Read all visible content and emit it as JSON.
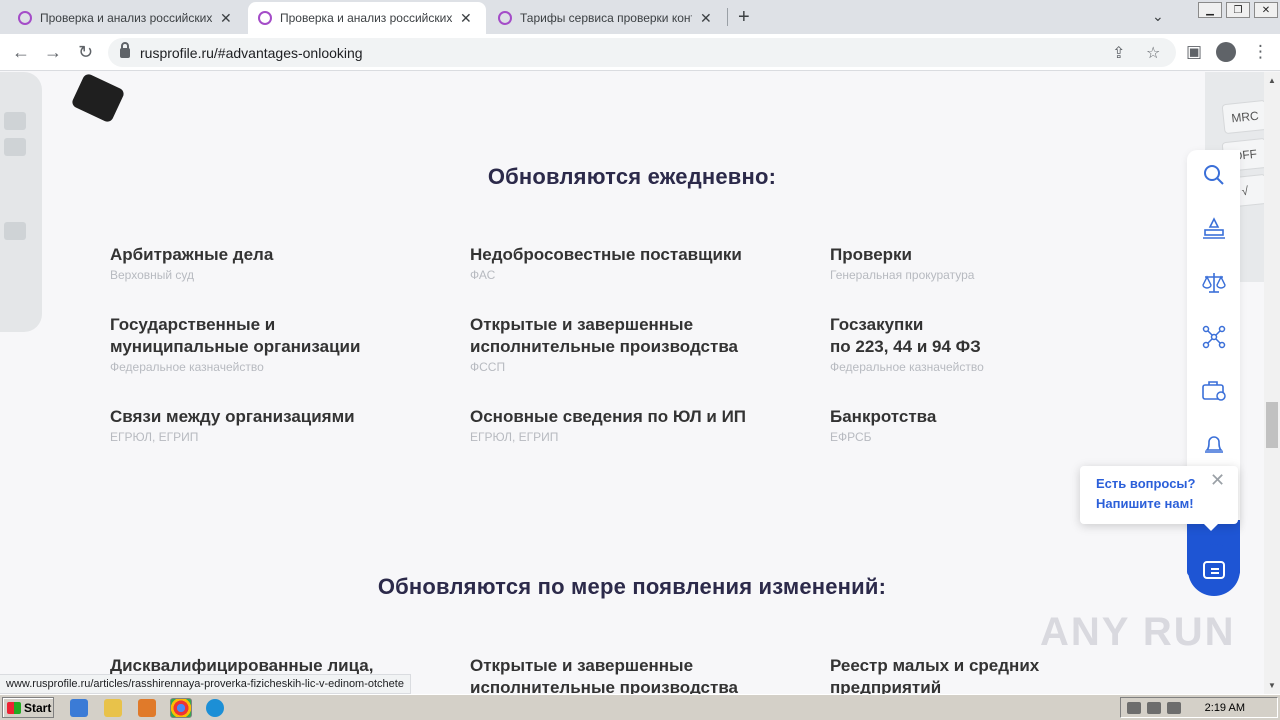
{
  "browser": {
    "tabs": [
      {
        "title": "Проверка и анализ российских юр",
        "close": "✕"
      },
      {
        "title": "Проверка и анализ российских юр",
        "close": "✕"
      },
      {
        "title": "Тарифы сервиса проверки контра",
        "close": "✕"
      }
    ],
    "new_tab": "+",
    "url": "rusprofile.ru/#advantages-onlooking"
  },
  "section_daily": {
    "heading": "Обновляются ежедневно:",
    "items": [
      {
        "title": "Арбитражные дела",
        "source": "Верховный суд"
      },
      {
        "title": "Недобросовестные поставщики",
        "source": "ФАС"
      },
      {
        "title": "Проверки",
        "source": "Генеральная прокуратура"
      },
      {
        "title_line1": "Государственные и",
        "title_line2": "муниципальные организации",
        "source": "Федеральное казначейство"
      },
      {
        "title_line1": "Открытые и завершенные",
        "title_line2": "исполнительные производства",
        "source": "ФССП"
      },
      {
        "title_line1": "Госзакупки",
        "title_line2": "по 223, 44 и 94 ФЗ",
        "source": "Федеральное казначейство"
      },
      {
        "title": "Связи между организациями",
        "source": "ЕГРЮЛ, ЕГРИП"
      },
      {
        "title": "Основные сведения по ЮЛ и ИП",
        "source": "ЕГРЮЛ, ЕГРИП"
      },
      {
        "title": "Банкротства",
        "source": "ЕФРСБ"
      }
    ]
  },
  "section_changes": {
    "heading": "Обновляются по мере появления изменений:",
    "items": [
      {
        "title": "Дисквалифицированные лица,"
      },
      {
        "title_line1": "Открытые и завершенные",
        "title_line2": "исполнительные производства"
      },
      {
        "title_line1": "Реестр малых и средних",
        "title_line2": "предприятий"
      }
    ]
  },
  "decor": {
    "calc_keys": [
      "MRC",
      "OFF",
      "√"
    ]
  },
  "chat_popup": {
    "line1": "Есть вопросы?",
    "line2": "Напишите нам!",
    "close": "✕"
  },
  "watermark": "ANY RUN",
  "status_url": "www.rusprofile.ru/articles/rasshirennaya-proverka-fizicheskih-lic-v-edinom-otchete",
  "taskbar": {
    "start": "Start",
    "clock": "2:19 AM"
  },
  "colors": {
    "heading": "#2c2a4a",
    "accent": "#1e55d4",
    "source_text": "#b7bac0"
  }
}
